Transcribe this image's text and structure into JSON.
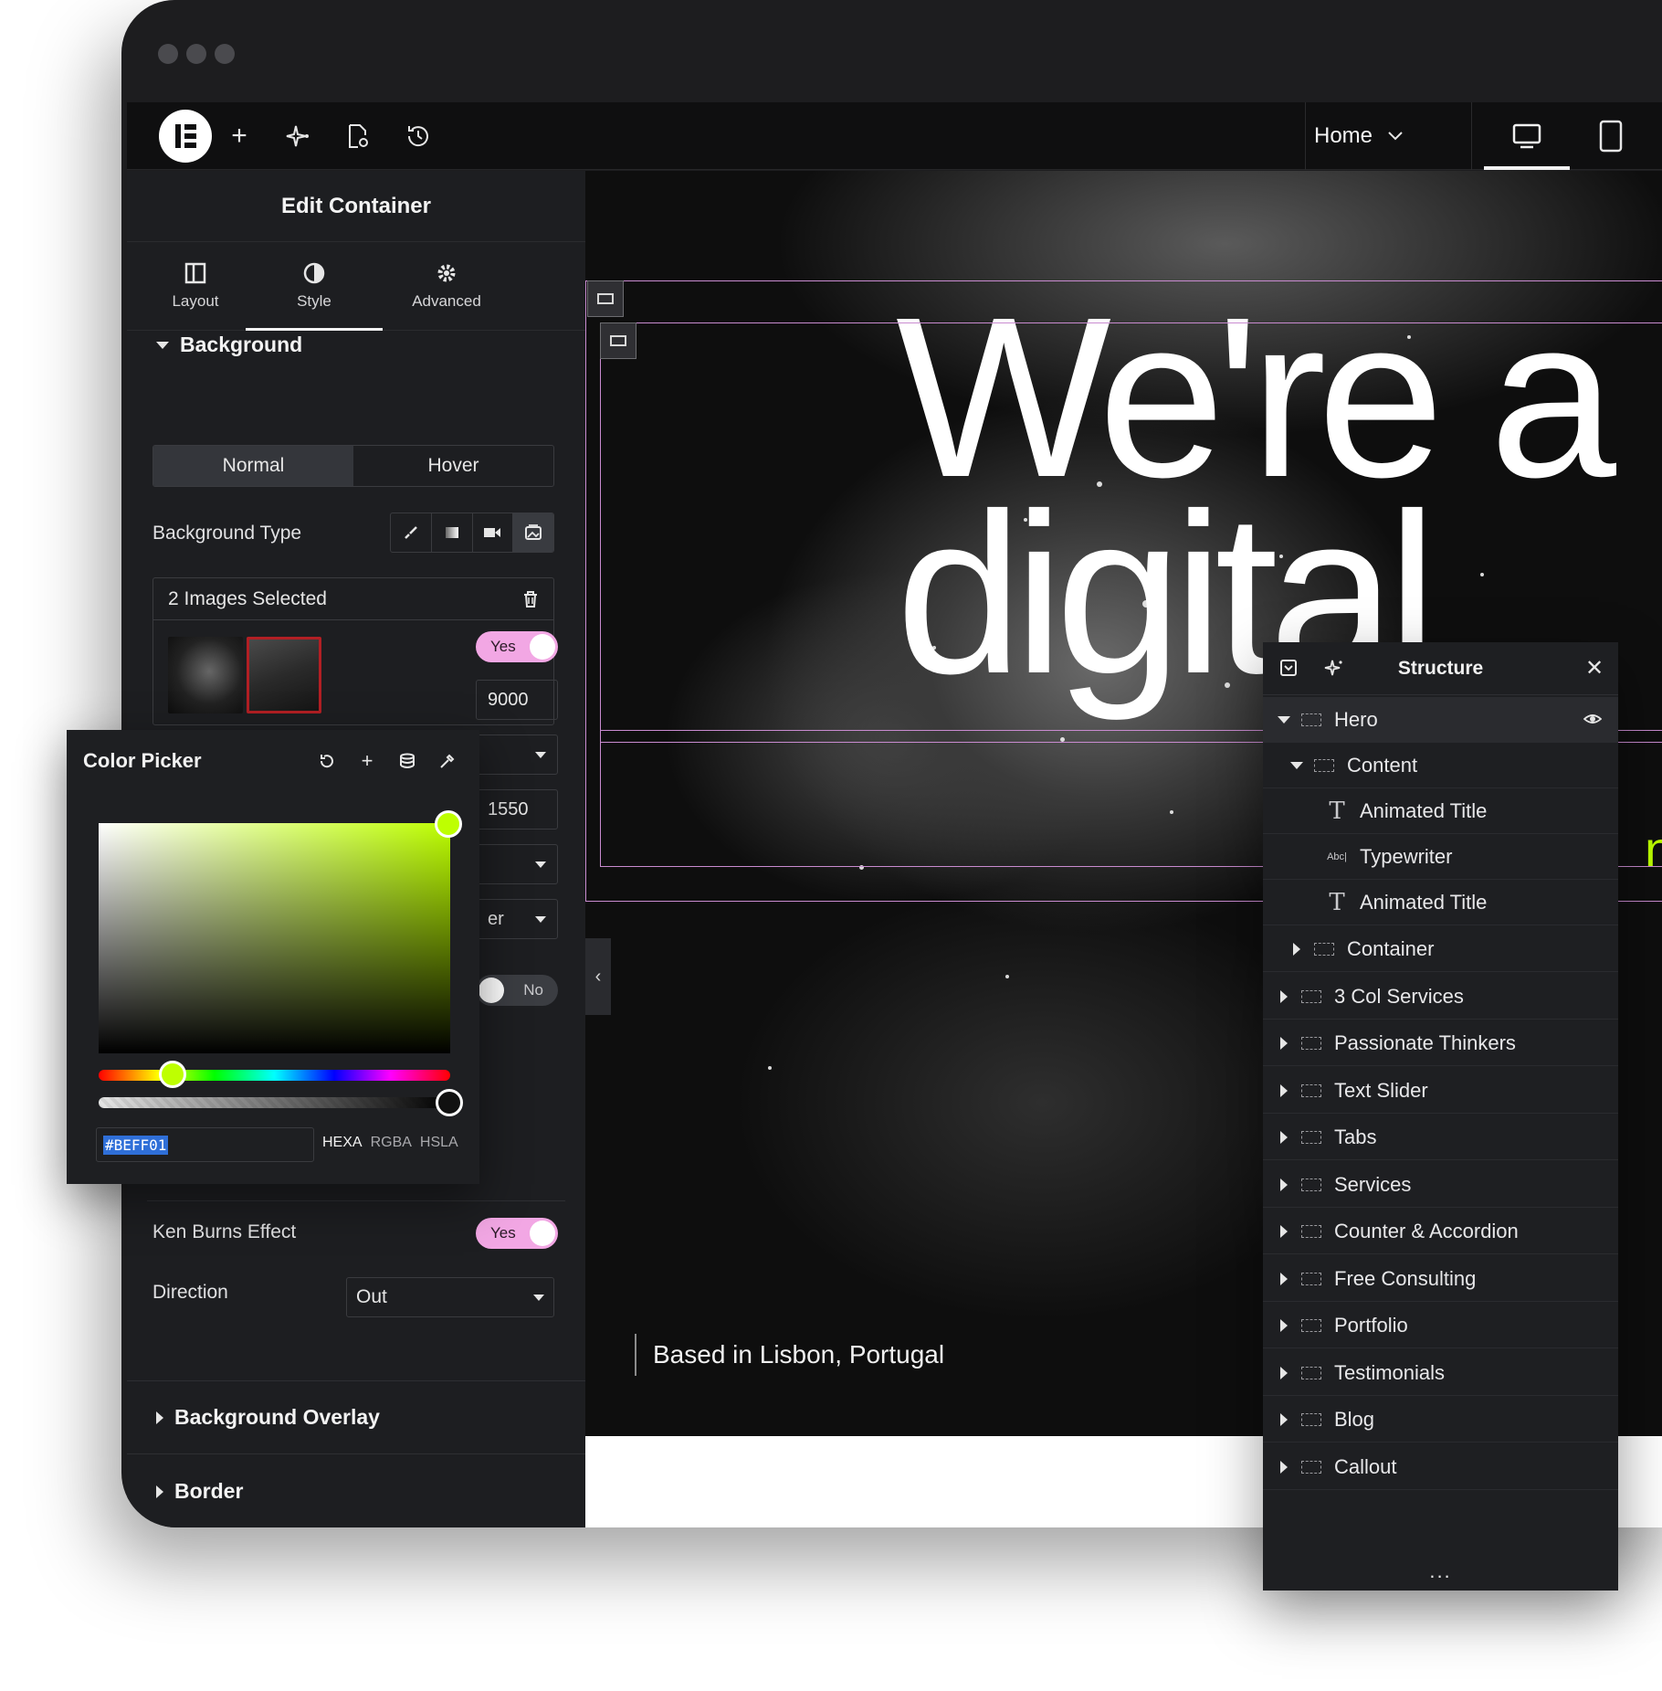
{
  "topbar": {
    "page_select": "Home"
  },
  "panel": {
    "title": "Edit Container",
    "tabs": [
      {
        "label": "Layout"
      },
      {
        "label": "Style"
      },
      {
        "label": "Advanced"
      }
    ],
    "active_tab": "Style",
    "sections": {
      "background": "Background",
      "background_overlay": "Background Overlay",
      "border": "Border"
    },
    "state_tabs": {
      "normal": "Normal",
      "hover": "Hover",
      "active": "Normal"
    },
    "background_type_label": "Background Type",
    "images_selected": "2 Images Selected",
    "toggle_yes": "Yes",
    "toggle_no": "No",
    "partial_values": [
      "9000",
      "1550",
      "er"
    ],
    "ken_burns_label": "Ken Burns Effect",
    "ken_burns_value": "Yes",
    "direction_label": "Direction",
    "direction_value": "Out"
  },
  "canvas": {
    "headline_line1": "We're a",
    "headline_line2": "digital",
    "accent_fragment": "nic",
    "based_in": "Based in Lisbon, Portugal"
  },
  "color_picker": {
    "title": "Color Picker",
    "hex_value": "#BEFF01",
    "formats": [
      "HEXA",
      "RGBA",
      "HSLA"
    ],
    "active_format": "HEXA",
    "selected_color": "#beff01"
  },
  "structure": {
    "title": "Structure",
    "items": [
      {
        "label": "Hero"
      },
      {
        "label": "Content"
      },
      {
        "label": "Animated Title"
      },
      {
        "label": "Typewriter"
      },
      {
        "label": "Animated Title"
      },
      {
        "label": "Container"
      },
      {
        "label": "3 Col Services"
      },
      {
        "label": "Passionate Thinkers"
      },
      {
        "label": "Text Slider"
      },
      {
        "label": "Tabs"
      },
      {
        "label": "Services"
      },
      {
        "label": "Counter & Accordion"
      },
      {
        "label": "Free Consulting"
      },
      {
        "label": "Portfolio"
      },
      {
        "label": "Testimonials"
      },
      {
        "label": "Blog"
      },
      {
        "label": "Callout"
      }
    ],
    "more": "..."
  },
  "colors": {
    "accent": "#beff01",
    "toggle_on": "#f2a7e4",
    "selection_outline": "#c98bd0"
  }
}
